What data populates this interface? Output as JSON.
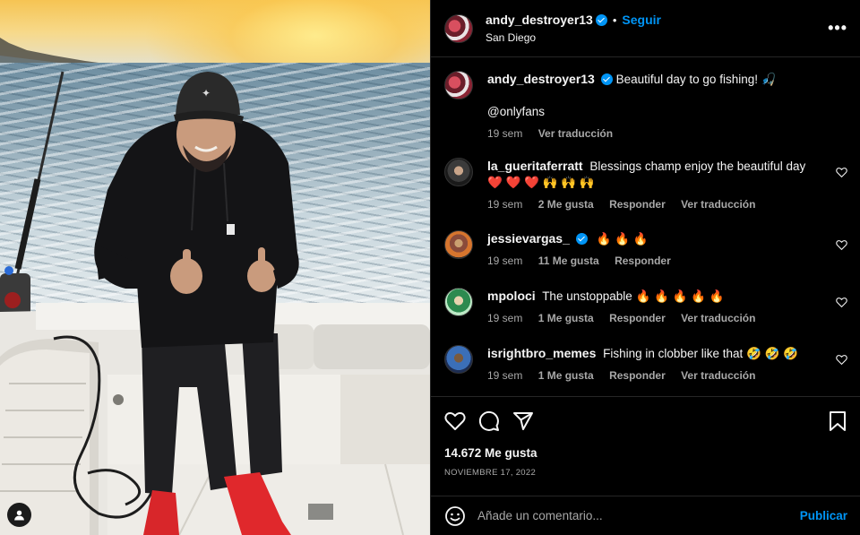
{
  "post": {
    "username": "andy_destroyer13",
    "verified": true,
    "follow_label": "Seguir",
    "location": "San Diego",
    "more_label": "•••"
  },
  "caption": {
    "username": "andy_destroyer13",
    "text": "Beautiful day to go fishing! 🎣",
    "mention": "@onlyfans",
    "time": "19 sem",
    "translate": "Ver traducción"
  },
  "comments": [
    {
      "username": "la_gueritaferratt",
      "verified": false,
      "text": "Blessings champ enjoy the beautiful day ❤️ ❤️ ❤️ 🙌 🙌 🙌",
      "time": "19 sem",
      "likes": "2 Me gusta",
      "reply": "Responder",
      "translate": "Ver traducción"
    },
    {
      "username": "jessievargas_",
      "verified": true,
      "text": "🔥 🔥 🔥",
      "time": "19 sem",
      "likes": "11 Me gusta",
      "reply": "Responder",
      "translate": ""
    },
    {
      "username": "mpoloci",
      "verified": false,
      "text": "The unstoppable 🔥 🔥 🔥 🔥 🔥",
      "time": "19 sem",
      "likes": "1 Me gusta",
      "reply": "Responder",
      "translate": "Ver traducción"
    },
    {
      "username": "isrightbro_memes",
      "verified": false,
      "text": "Fishing in clobber like that 🤣 🤣 🤣",
      "time": "19 sem",
      "likes": "1 Me gusta",
      "reply": "Responder",
      "translate": "Ver traducción"
    }
  ],
  "footer": {
    "likes": "14.672 Me gusta",
    "date": "NOVIEMBRE 17, 2022",
    "comment_placeholder": "Añade un comentario...",
    "publish_label": "Publicar"
  },
  "colors": {
    "accent": "#0095f6",
    "background": "#000000",
    "text": "#f5f5f5",
    "secondary_text": "#a8a8a8"
  }
}
